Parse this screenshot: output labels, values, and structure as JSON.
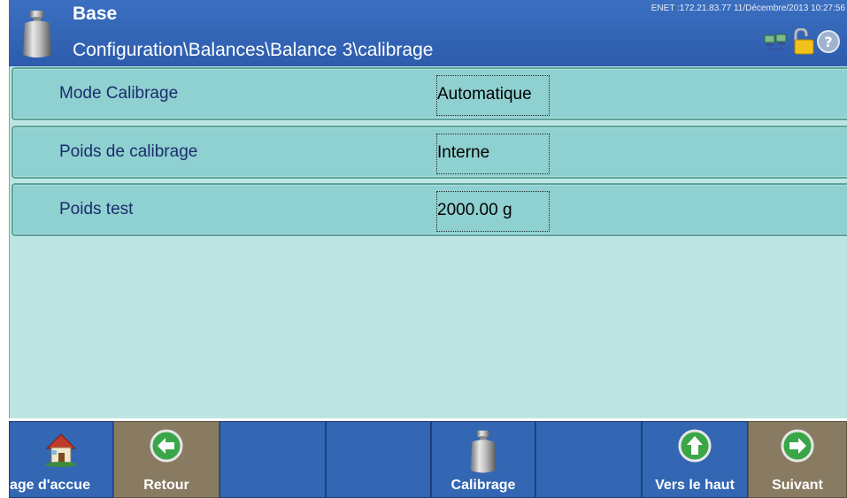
{
  "header": {
    "title": "Base",
    "path": "Configuration\\Balances\\Balance 3\\calibrage",
    "status": "ENET :172.21.83.77  11/Décembre/2013 10:27:56",
    "icons": [
      "weight-icon",
      "network-icon",
      "unlock-icon",
      "help-icon"
    ]
  },
  "rows": [
    {
      "label": "Mode Calibrage",
      "value": "Automatique"
    },
    {
      "label": "Poids de calibrage",
      "value": "Interne"
    },
    {
      "label": "Poids test",
      "value": "2000.00 g"
    }
  ],
  "footer": {
    "buttons": [
      {
        "label": "age d'accue",
        "icon": "home-icon",
        "color": "blue"
      },
      {
        "label": "Retour",
        "icon": "arrow-left-icon",
        "color": "tan"
      },
      {
        "label": "",
        "icon": "",
        "color": "blue"
      },
      {
        "label": "",
        "icon": "",
        "color": "blue"
      },
      {
        "label": "Calibrage",
        "icon": "weight-icon",
        "color": "blue"
      },
      {
        "label": "",
        "icon": "",
        "color": "blue"
      },
      {
        "label": "Vers le haut",
        "icon": "arrow-up-icon",
        "color": "blue"
      },
      {
        "label": "Suivant",
        "icon": "arrow-right-icon",
        "color": "tan"
      }
    ]
  },
  "colors": {
    "header": "#2d5cad",
    "content_bg": "#bde6e2",
    "row_bg": "#8fd0d0",
    "button_blue": "#3366b3",
    "button_tan": "#887b62"
  }
}
